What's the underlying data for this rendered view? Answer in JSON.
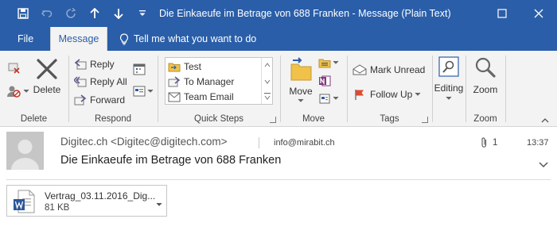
{
  "window": {
    "title": "Die Einkaeufe im Betrage von 688 Franken  -  Message (Plain Text)",
    "accent_color": "#2a5ea8"
  },
  "quick_access": {
    "save_icon": "save-icon",
    "undo_icon": "undo-icon",
    "redo_icon": "redo-icon",
    "previous_icon": "up-arrow-icon",
    "next_icon": "down-arrow-icon",
    "customize_icon": "customize-icon"
  },
  "tabs": {
    "file": "File",
    "message": "Message",
    "tell_me": "Tell me what you want to do"
  },
  "ribbon": {
    "delete_group": {
      "delete_label": "Delete",
      "group_label": "Delete"
    },
    "respond_group": {
      "reply": "Reply",
      "reply_all": "Reply All",
      "forward": "Forward",
      "group_label": "Respond"
    },
    "quick_steps_group": {
      "items": [
        "Test",
        "To Manager",
        "Team Email"
      ],
      "group_label": "Quick Steps"
    },
    "move_group": {
      "move_label": "Move",
      "group_label": "Move"
    },
    "tags_group": {
      "mark_unread": "Mark Unread",
      "follow_up": "Follow Up",
      "group_label": "Tags"
    },
    "editing_group": {
      "editing_label": "Editing"
    },
    "zoom_group": {
      "zoom_label": "Zoom",
      "group_label": "Zoom"
    }
  },
  "message": {
    "from": "Digitec.ch <Digitec@digitech.com>",
    "to": "info@mirabit.ch",
    "attachment_count": "1",
    "time": "13:37",
    "subject": "Die Einkaeufe im Betrage von 688 Franken"
  },
  "attachment": {
    "name": "Vertrag_03.11.2016_Dig...",
    "size": "81 KB",
    "icon": "word-document-icon"
  }
}
